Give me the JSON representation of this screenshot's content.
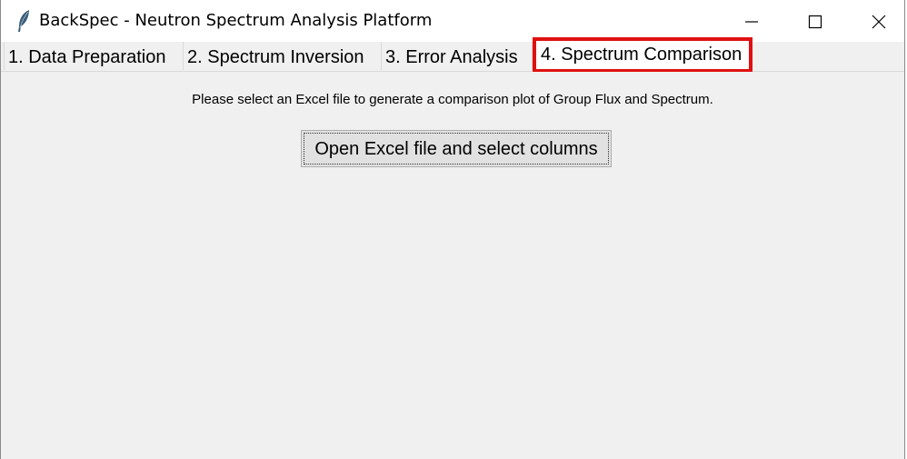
{
  "window": {
    "title": "BackSpec - Neutron Spectrum Analysis Platform",
    "app_icon": "feather-icon",
    "controls": {
      "minimize_icon": "minimize-icon",
      "maximize_icon": "maximize-icon",
      "close_icon": "close-icon"
    }
  },
  "tabs": [
    {
      "label": "1.  Data Preparation",
      "selected": false
    },
    {
      "label": "2.  Spectrum Inversion",
      "selected": false
    },
    {
      "label": "3.  Error Analysis",
      "selected": false
    },
    {
      "label": "4. Spectrum Comparison",
      "selected": true
    }
  ],
  "highlight_color": "#e01010",
  "main": {
    "instruction": "Please select an Excel file to generate a comparison plot of Group Flux and Spectrum.",
    "open_button_label": "Open Excel file and select columns"
  }
}
